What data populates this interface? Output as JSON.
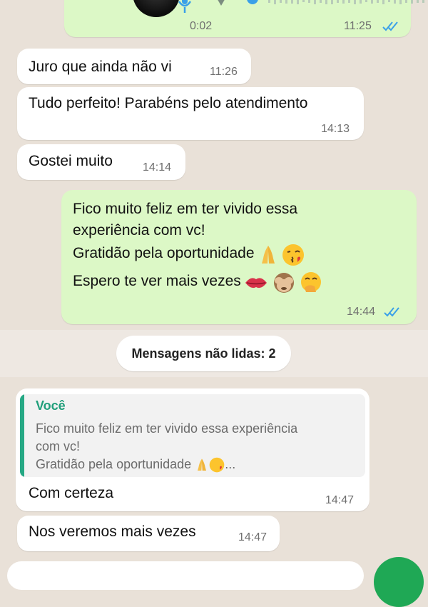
{
  "audio_message": {
    "duration": "0:02",
    "time": "11:25",
    "status": "read"
  },
  "messages": [
    {
      "text": "Juro que ainda não vi",
      "time": "11:26"
    },
    {
      "text": "Tudo perfeito! Parabéns pelo atendimento",
      "time": "14:13"
    },
    {
      "text": "Gostei muito",
      "time": "14:14"
    }
  ],
  "outgoing": {
    "line1": "Fico muito feliz em ter vivido essa",
    "line2": "experiência com vc!",
    "line3": "Gratidão pela oportunidade",
    "line4": "Espero te ver mais vezes",
    "time": "14:44",
    "status": "read"
  },
  "unread_banner": "Mensagens não lidas: 2",
  "reply": {
    "quote_author": "Você",
    "quote_line1": "Fico muito feliz em ter vivido essa experiência",
    "quote_line2": "com vc!",
    "quote_line3": "Gratidão pela oportunidade",
    "quote_ellipsis": "...",
    "text": "Com certeza",
    "time": "14:47"
  },
  "last_message": {
    "text": "Nos veremos mais vezes",
    "time": "14:47"
  },
  "colors": {
    "outgoing_bubble": "#dcf8c6",
    "incoming_bubble": "#ffffff",
    "tick_read": "#3aa0e8",
    "accent": "#25a884"
  },
  "icons": [
    "mic-icon",
    "play-icon",
    "double-check-icon",
    "folded-hands-emoji",
    "kiss-emoji",
    "lips-emoji",
    "see-no-evil-monkey-emoji",
    "hand-over-mouth-emoji"
  ]
}
